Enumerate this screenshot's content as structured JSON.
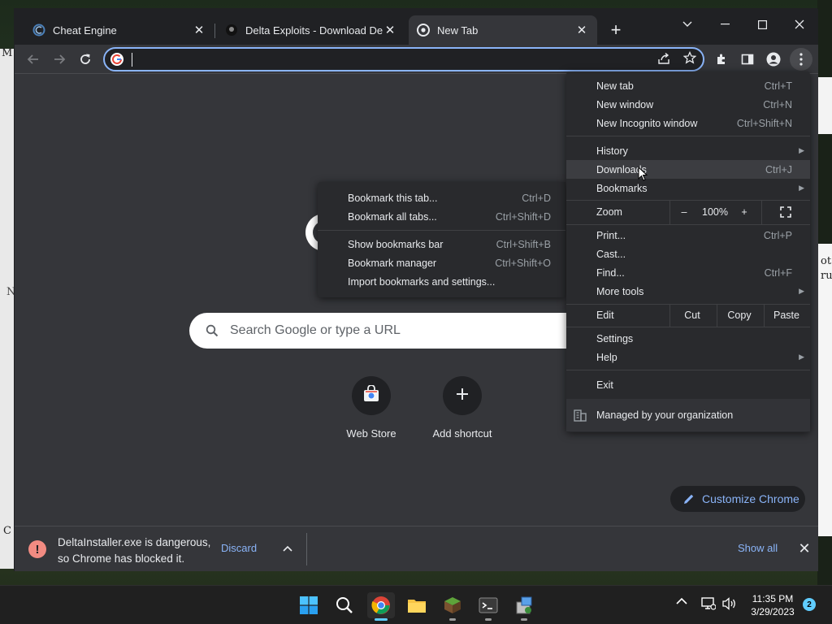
{
  "tabs": [
    {
      "title": "Cheat Engine"
    },
    {
      "title": "Delta Exploits - Download Delta"
    },
    {
      "title": "New Tab"
    }
  ],
  "omnibox": {
    "value": "",
    "placeholder": ""
  },
  "ntp": {
    "search_placeholder": "Search Google or type a URL",
    "shortcuts": [
      {
        "label": "Web Store"
      },
      {
        "label": "Add shortcut"
      }
    ],
    "customize_label": "Customize Chrome"
  },
  "desktop_text": {
    "left_top": "M",
    "left_mid": "N",
    "left_bot": "C",
    "right_a": "ot",
    "right_b": "ru"
  },
  "main_menu": {
    "new_tab": {
      "label": "New tab",
      "shortcut": "Ctrl+T"
    },
    "new_window": {
      "label": "New window",
      "shortcut": "Ctrl+N"
    },
    "new_incognito": {
      "label": "New Incognito window",
      "shortcut": "Ctrl+Shift+N"
    },
    "history": {
      "label": "History"
    },
    "downloads": {
      "label": "Downloads",
      "shortcut": "Ctrl+J"
    },
    "bookmarks": {
      "label": "Bookmarks"
    },
    "zoom": {
      "label": "Zoom",
      "minus": "–",
      "value": "100%",
      "plus": "+"
    },
    "print": {
      "label": "Print...",
      "shortcut": "Ctrl+P"
    },
    "cast": {
      "label": "Cast..."
    },
    "find": {
      "label": "Find...",
      "shortcut": "Ctrl+F"
    },
    "more_tools": {
      "label": "More tools"
    },
    "edit": {
      "label": "Edit",
      "cut": "Cut",
      "copy": "Copy",
      "paste": "Paste"
    },
    "settings": {
      "label": "Settings"
    },
    "help": {
      "label": "Help"
    },
    "exit": {
      "label": "Exit"
    },
    "managed": {
      "label": "Managed by your organization"
    }
  },
  "bookmarks_menu": {
    "bookmark_tab": {
      "label": "Bookmark this tab...",
      "shortcut": "Ctrl+D"
    },
    "bookmark_all": {
      "label": "Bookmark all tabs...",
      "shortcut": "Ctrl+Shift+D"
    },
    "show_bar": {
      "label": "Show bookmarks bar",
      "shortcut": "Ctrl+Shift+B"
    },
    "manager": {
      "label": "Bookmark manager",
      "shortcut": "Ctrl+Shift+O"
    },
    "import": {
      "label": "Import bookmarks and settings..."
    }
  },
  "download_bar": {
    "line1": "DeltaInstaller.exe is dangerous,",
    "line2": "so Chrome has blocked it.",
    "discard": "Discard",
    "show_all": "Show all"
  },
  "taskbar": {
    "time": "11:35 PM",
    "date": "3/29/2023",
    "notifications": "2"
  },
  "colors": {
    "accent": "#8ab4f8",
    "menu_bg": "#292a2d",
    "page_bg": "#35363a",
    "danger": "#f28b82"
  }
}
